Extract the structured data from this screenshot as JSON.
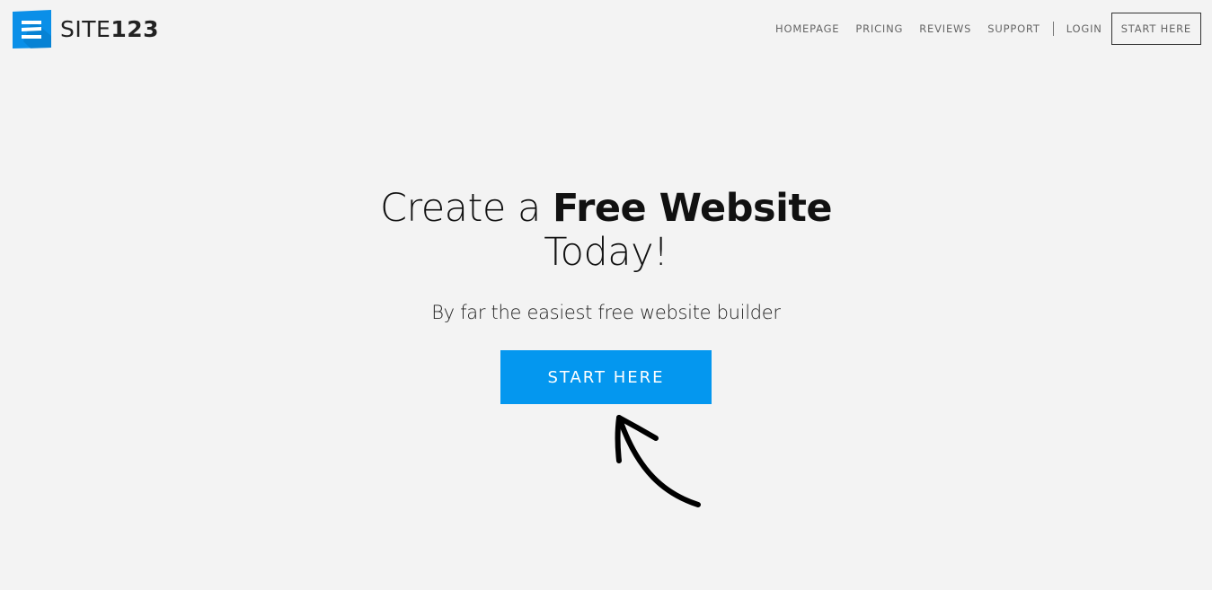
{
  "brand": {
    "name_light": "SITE",
    "name_bold": "123",
    "icon": "site123-logo-icon",
    "accent_color": "#0497ef"
  },
  "nav": {
    "items": [
      {
        "label": "HOMEPAGE"
      },
      {
        "label": "PRICING"
      },
      {
        "label": "REVIEWS"
      },
      {
        "label": "SUPPORT"
      },
      {
        "label": "LOGIN"
      }
    ],
    "cta_label": "START HERE"
  },
  "hero": {
    "title_prefix": "Create a ",
    "title_bold": "Free Website",
    "title_line2": "Today!",
    "subtitle": "By far the easiest free website builder",
    "cta_label": "START HERE",
    "arrow_icon": "hand-drawn-arrow-icon"
  }
}
